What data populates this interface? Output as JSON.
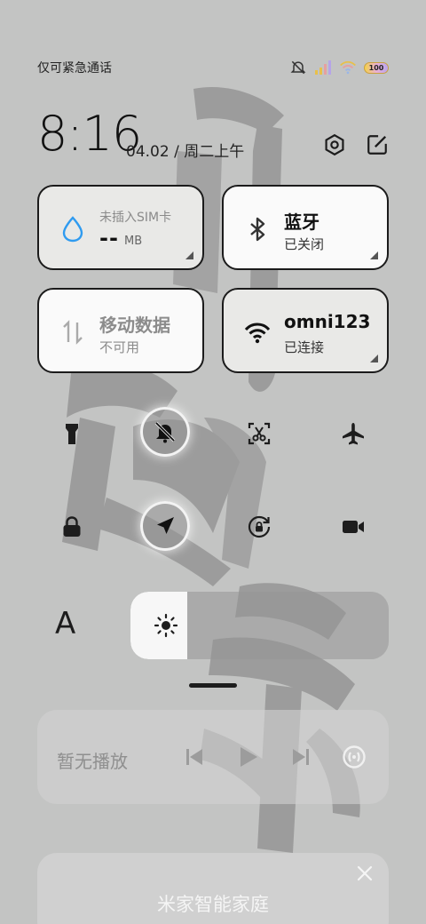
{
  "status_bar": {
    "carrier_text": "仅可紧急通话",
    "battery_level": "100",
    "icons": [
      "silent-icon",
      "signal-icon",
      "wifi-icon",
      "battery-icon"
    ]
  },
  "header": {
    "time": "8:16",
    "date": "04.02 / 周二上午",
    "icons": [
      "settings-icon",
      "edit-icon"
    ]
  },
  "tiles": {
    "data_usage": {
      "label": "未插入SIM卡",
      "value": "--",
      "unit": "MB",
      "icon": "water-drop-icon"
    },
    "bluetooth": {
      "title": "蓝牙",
      "status": "已关闭",
      "icon": "bluetooth-icon"
    },
    "mobile_data": {
      "title": "移动数据",
      "status": "不可用",
      "icon": "data-arrows-icon"
    },
    "wifi": {
      "title": "omni123",
      "status": "已连接",
      "icon": "wifi-icon"
    }
  },
  "toggles": [
    {
      "name": "flashlight",
      "icon": "flashlight-icon",
      "active": false
    },
    {
      "name": "mute",
      "icon": "bell-off-icon",
      "active": true
    },
    {
      "name": "screenshot",
      "icon": "screenshot-icon",
      "active": false
    },
    {
      "name": "airplane",
      "icon": "airplane-icon",
      "active": false
    },
    {
      "name": "lock",
      "icon": "lock-icon",
      "active": false
    },
    {
      "name": "location",
      "icon": "location-icon",
      "active": true
    },
    {
      "name": "rotation-lock",
      "icon": "rotation-lock-icon",
      "active": false
    },
    {
      "name": "screen-record",
      "icon": "video-icon",
      "active": false
    }
  ],
  "brightness": {
    "font_label": "A",
    "level": 0.22
  },
  "media": {
    "text": "暂无播放"
  },
  "smart_home": {
    "title": "米家智能家庭"
  },
  "colors": {
    "background": "#c3c4c3",
    "accent_blue": "#2f9bf0",
    "tile_light": "#e9e9e7"
  }
}
